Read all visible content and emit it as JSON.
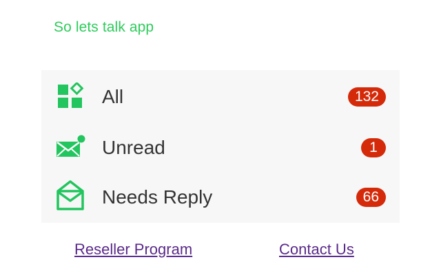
{
  "app": {
    "title": "So lets talk app"
  },
  "filters": [
    {
      "label": "All",
      "count": "132",
      "icon": "apps-grid-icon"
    },
    {
      "label": "Unread",
      "count": "1",
      "icon": "mail-unread-icon"
    },
    {
      "label": "Needs Reply",
      "count": "66",
      "icon": "mail-open-icon"
    }
  ],
  "footer": {
    "reseller_label": "Reseller Program",
    "contact_label": "Contact Us"
  },
  "colors": {
    "accent_green": "#2ecc5b",
    "icon_green": "#22c55e",
    "badge_red": "#d42a0a",
    "link_purple": "#5a2a8a",
    "panel_bg": "#f7f7f7"
  }
}
